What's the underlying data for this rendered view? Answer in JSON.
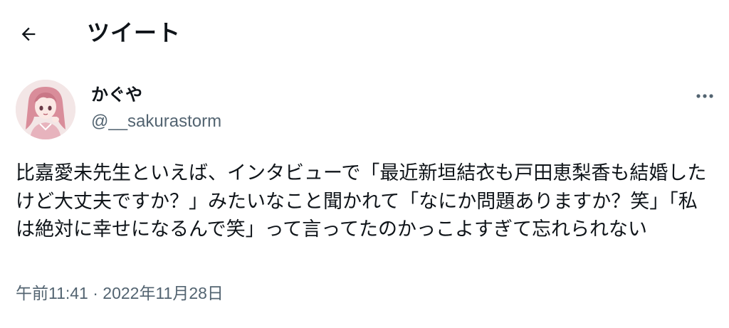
{
  "header": {
    "back_icon": "arrow-left-icon",
    "title": "ツイート"
  },
  "tweet": {
    "author": {
      "display_name": "かぐや",
      "handle": "@__sakurastorm",
      "avatar": "pink-haired-anime-girl-avatar"
    },
    "more_icon": "more-horizontal-icon",
    "text": "比嘉愛未先生といえば、インタビューで「最近新垣結衣も戸田恵梨香も結婚したけど大丈夫ですか？」みたいなこと聞かれて「なにか問題ありますか？笑」「私は絶対に幸せになるんで笑」って言ってたのかっこよすぎて忘れられない",
    "timestamp": "午前11:41 · 2022年11月28日"
  },
  "colors": {
    "text_primary": "#0f1419",
    "text_secondary": "#536471",
    "background": "#ffffff"
  }
}
